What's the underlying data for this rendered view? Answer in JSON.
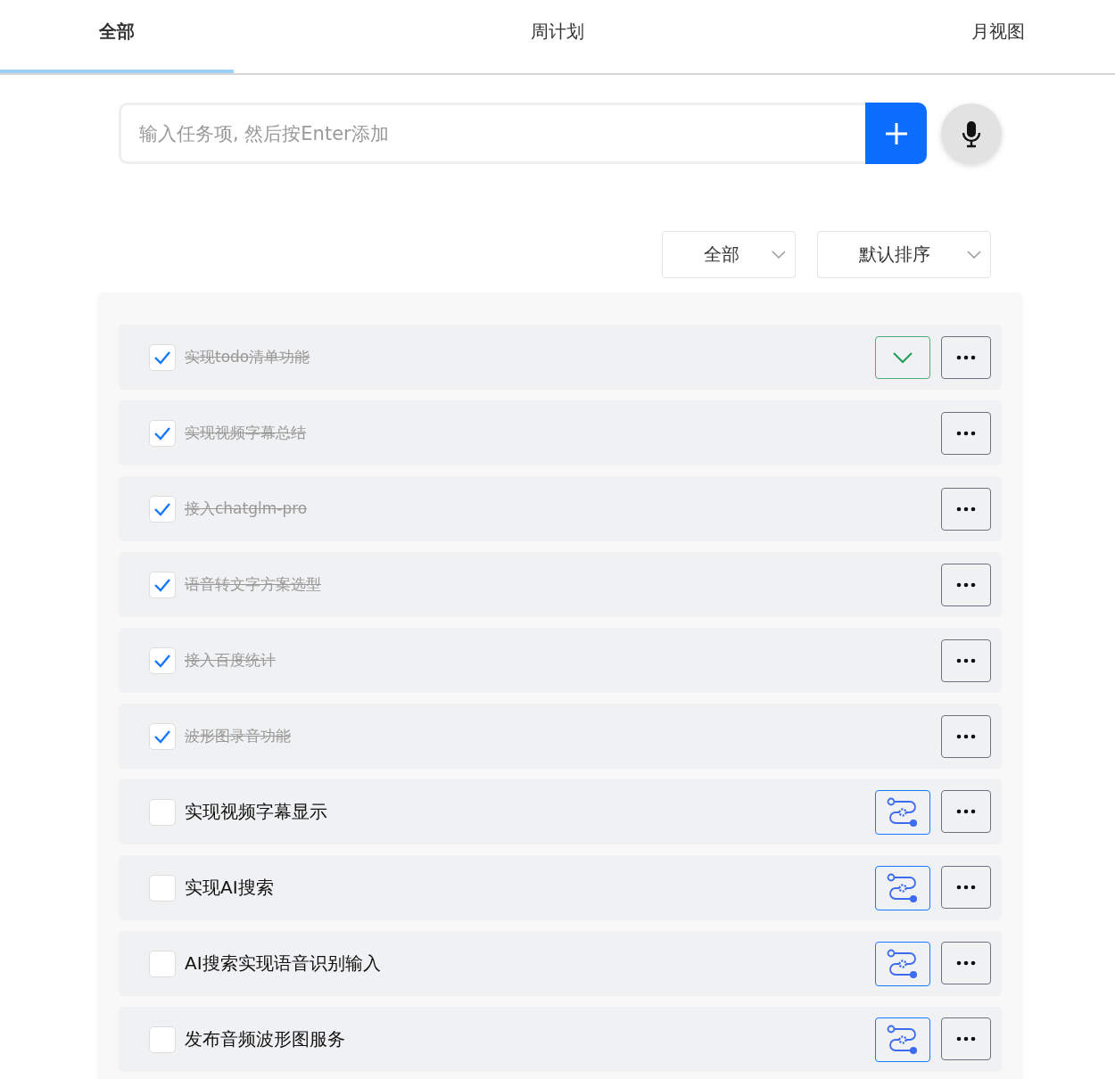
{
  "tabs": [
    {
      "label": "全部",
      "selected": true
    },
    {
      "label": "周计划",
      "selected": false
    },
    {
      "label": "月视图",
      "selected": false
    }
  ],
  "task_input": {
    "placeholder": "输入任务项, 然后按Enter添加"
  },
  "filters": [
    {
      "value": "全部"
    },
    {
      "value": "默认排序"
    }
  ],
  "tasks": [
    {
      "title": "实现todo清单功能",
      "checked": true,
      "kind": "confirm"
    },
    {
      "title": "实现视频字幕总结",
      "checked": true,
      "kind": "plain"
    },
    {
      "title": "接入chatglm-pro",
      "checked": true,
      "kind": "plain"
    },
    {
      "title": "语音转文字方案选型",
      "checked": true,
      "kind": "plain"
    },
    {
      "title": "接入百度统计",
      "checked": true,
      "kind": "plain"
    },
    {
      "title": "波形图录音功能",
      "checked": true,
      "kind": "plain"
    },
    {
      "title": "实现视频字幕显示",
      "checked": false,
      "kind": "workflow"
    },
    {
      "title": "实现AI搜索",
      "checked": false,
      "kind": "workflow"
    },
    {
      "title": "AI搜索实现语音识别输入",
      "checked": false,
      "kind": "workflow"
    },
    {
      "title": "发布音频波形图服务",
      "checked": false,
      "kind": "workflow"
    }
  ]
}
